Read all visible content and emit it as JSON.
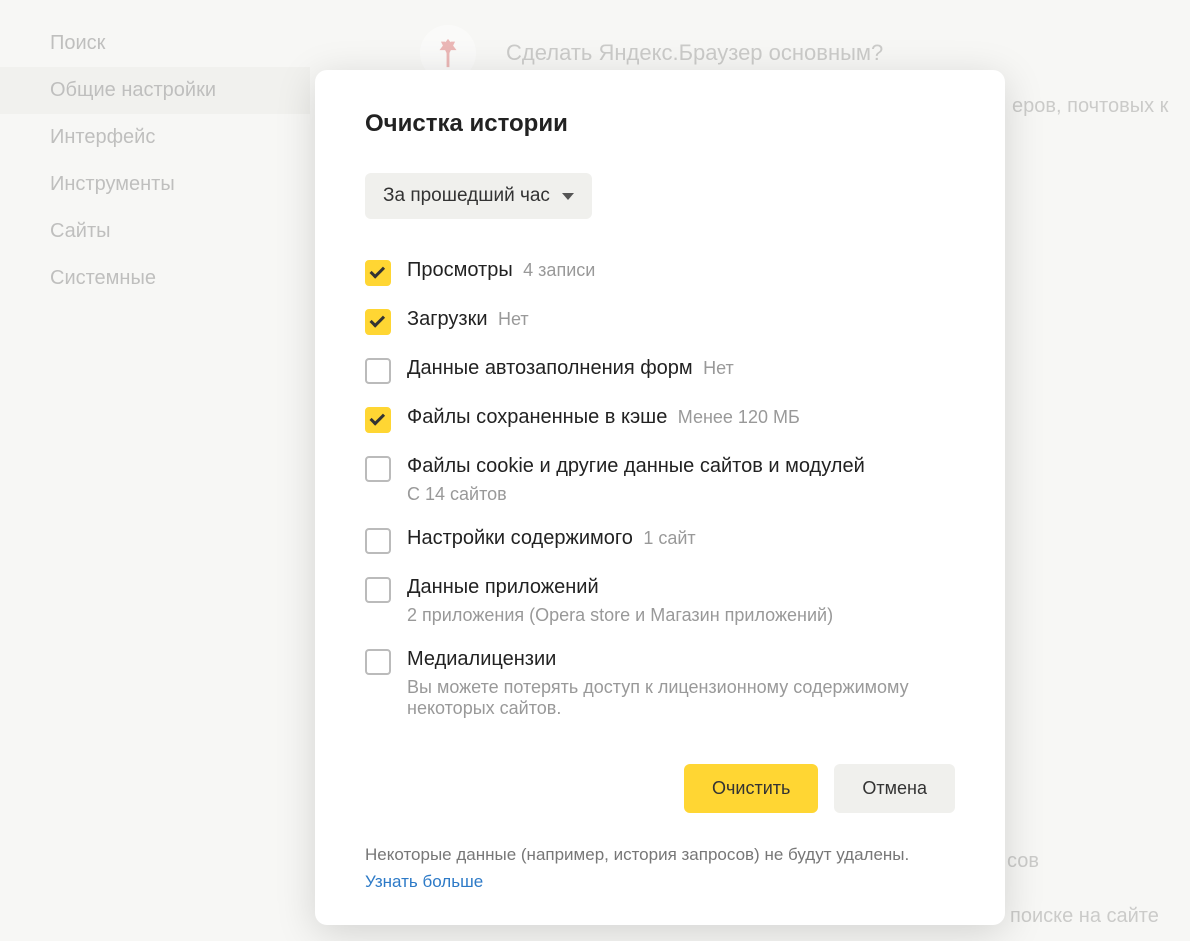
{
  "sidebar": {
    "items": [
      {
        "label": "Поиск"
      },
      {
        "label": "Общие настройки"
      },
      {
        "label": "Интерфейс"
      },
      {
        "label": "Инструменты"
      },
      {
        "label": "Сайты"
      },
      {
        "label": "Системные"
      }
    ]
  },
  "background": {
    "header_text": "Сделать Яндекс.Браузер основным?",
    "text_right_1": "еров, почтовых к",
    "text_right_2": "сов",
    "text_right_3": "поиске на сайте"
  },
  "modal": {
    "title": "Очистка истории",
    "time_range": "За прошедший час",
    "items": [
      {
        "label": "Просмотры",
        "meta": "4 записи",
        "checked": true,
        "meta_inline": true
      },
      {
        "label": "Загрузки",
        "meta": "Нет",
        "checked": true,
        "meta_inline": true
      },
      {
        "label": "Данные автозаполнения форм",
        "meta": "Нет",
        "checked": false,
        "meta_inline": true
      },
      {
        "label": "Файлы сохраненные в кэше",
        "meta": "Менее 120 МБ",
        "checked": true,
        "meta_inline": true
      },
      {
        "label": "Файлы cookie и другие данные сайтов и модулей",
        "meta": "С 14 сайтов",
        "checked": false,
        "meta_inline": false
      },
      {
        "label": "Настройки содержимого",
        "meta": "1 сайт",
        "checked": false,
        "meta_inline": true
      },
      {
        "label": "Данные приложений",
        "meta": "2 приложения (Opera store и Магазин приложений)",
        "checked": false,
        "meta_inline": false
      },
      {
        "label": "Медиалицензии",
        "meta": "Вы можете потерять доступ к лицензионному содержимому некоторых сайтов.",
        "checked": false,
        "meta_inline": false
      }
    ],
    "actions": {
      "clear": "Очистить",
      "cancel": "Отмена"
    },
    "footer": {
      "text": "Некоторые данные (например, история запросов) не будут удалены.",
      "link": "Узнать больше"
    }
  }
}
